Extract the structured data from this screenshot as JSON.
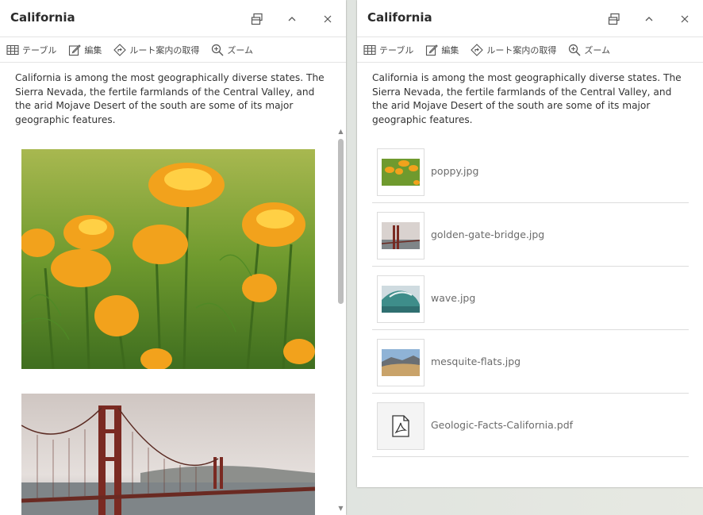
{
  "panels": [
    {
      "title": "California",
      "toolbar": {
        "table": "テーブル",
        "edit": "編集",
        "directions": "ルート案内の取得",
        "zoom": "ズーム"
      },
      "description": "California is among the most geographically diverse states. The Sierra Nevada, the fertile farmlands of the Central Valley, and the arid Mojave Desert of the south are some of its major geographic features."
    },
    {
      "title": "California",
      "toolbar": {
        "table": "テーブル",
        "edit": "編集",
        "directions": "ルート案内の取得",
        "zoom": "ズーム"
      },
      "description": "California is among the most geographically diverse states. The Sierra Nevada, the fertile farmlands of the Central Valley, and the arid Mojave Desert of the south are some of its major geographic features.",
      "attachments": [
        {
          "name": "poppy.jpg",
          "icon": "image-thumb"
        },
        {
          "name": "golden-gate-bridge.jpg",
          "icon": "image-thumb"
        },
        {
          "name": "wave.jpg",
          "icon": "image-thumb"
        },
        {
          "name": "mesquite-flats.jpg",
          "icon": "image-thumb"
        },
        {
          "name": "Geologic-Facts-California.pdf",
          "icon": "pdf-icon"
        }
      ]
    }
  ],
  "colors": {
    "panel_bg": "#ffffff",
    "text": "#333333",
    "muted": "#6b6b6b",
    "divider": "#dcdcdc"
  }
}
